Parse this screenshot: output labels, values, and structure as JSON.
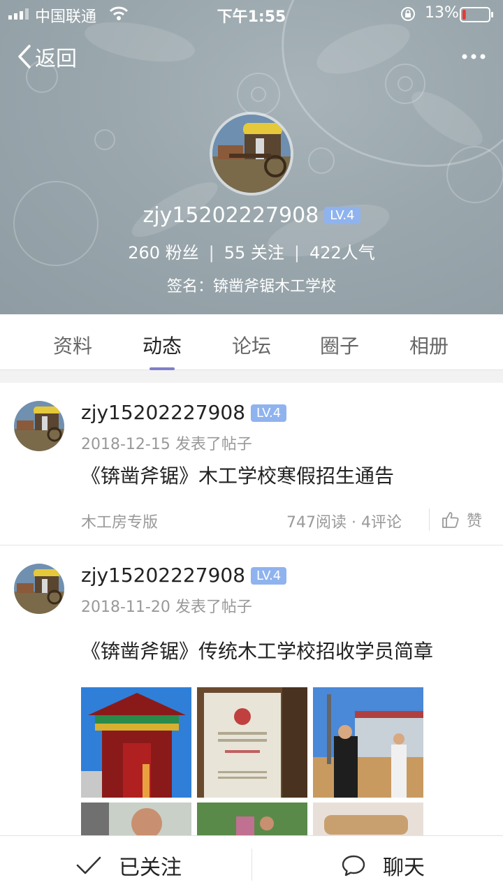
{
  "status_bar": {
    "carrier": "中国联通",
    "time": "下午1:55",
    "battery_percent": "13%",
    "battery_level": 0.13
  },
  "nav": {
    "back_label": "返回",
    "more_icon": "more-icon"
  },
  "profile": {
    "username": "zjy15202227908",
    "level": "LV.4",
    "fans": "260 粉丝",
    "following": "55 关注",
    "popularity": "422人气",
    "stats_separator": "|",
    "signature": "签名：锛凿斧锯木工学校"
  },
  "tabs": [
    {
      "label": "资料"
    },
    {
      "label": "动态"
    },
    {
      "label": "论坛"
    },
    {
      "label": "圈子"
    },
    {
      "label": "相册"
    }
  ],
  "active_tab_index": 1,
  "posts": [
    {
      "author": "zjy15202227908",
      "level": "LV.4",
      "meta": "2018-12-15 发表了帖子",
      "title": "《锛凿斧锯》木工学校寒假招生通告",
      "board": "木工房专版",
      "counts": "747阅读 · 4评论",
      "like_label": "赞"
    },
    {
      "author": "zjy15202227908",
      "level": "LV.4",
      "meta": "2018-11-20 发表了帖子",
      "title": "《锛凿斧锯》传统木工学校招收学员简章"
    }
  ],
  "bottom_bar": {
    "follow_label": "已关注",
    "chat_label": "聊天"
  },
  "colors": {
    "header_bg": "#9aa7ad",
    "level_badge": "#8fb3ee",
    "tab_indicator": "#7f7fc9"
  }
}
